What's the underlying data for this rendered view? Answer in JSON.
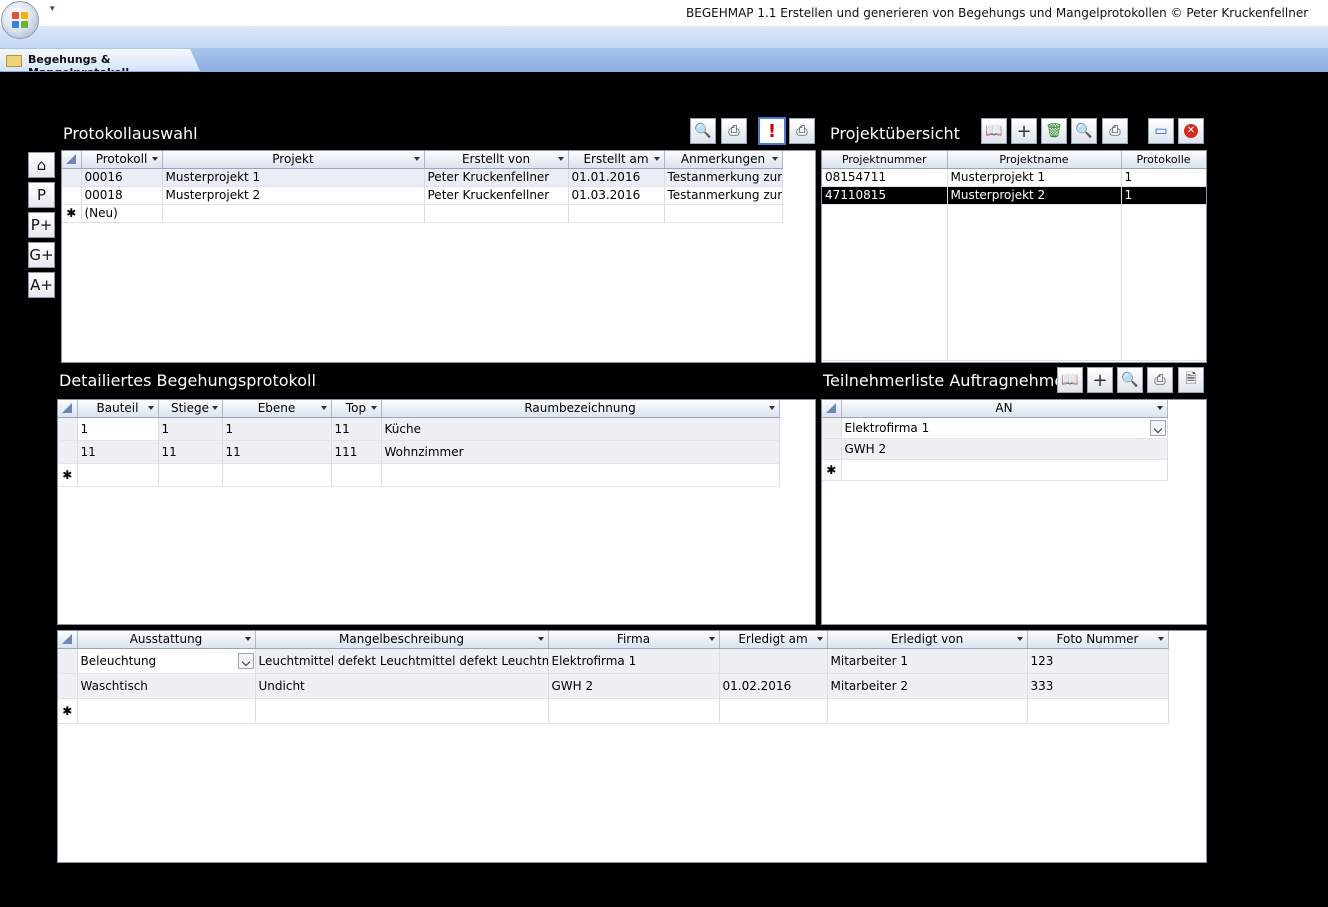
{
  "window": {
    "title": "BEGEHMAP 1.1 Erstellen und generieren von Begehungs und Mangelprotokollen © Peter Kruckenfellner",
    "tab_label": "Begehungs & Mangelprotokoll"
  },
  "nav": [
    {
      "label": "⌂",
      "icon": "home-icon"
    },
    {
      "label": "P"
    },
    {
      "label": "P+"
    },
    {
      "label": "G+"
    },
    {
      "label": "A+"
    }
  ],
  "protokoll": {
    "heading": "Protokollauswahl",
    "columns": [
      "Protokoll",
      "Projekt",
      "Erstellt von",
      "Erstellt am",
      "Anmerkungen"
    ],
    "rows": [
      {
        "protokoll": "00016",
        "projekt": "Musterprojekt 1",
        "erstellt_von": "Peter Kruckenfellner",
        "erstellt_am": "01.01.2016",
        "anmerkungen": "Testanmerkung zur"
      },
      {
        "protokoll": "00018",
        "projekt": "Musterprojekt 2",
        "erstellt_von": "Peter Kruckenfellner",
        "erstellt_am": "01.03.2016",
        "anmerkungen": "Testanmerkung zur"
      }
    ],
    "new_row": "(Neu)"
  },
  "projekt": {
    "heading": "Projektübersicht",
    "columns": [
      "Projektnummer",
      "Projektname",
      "Protokolle"
    ],
    "rows": [
      {
        "nummer": "08154711",
        "name": "Musterprojekt 1",
        "protokolle": "1"
      },
      {
        "nummer": "47110815",
        "name": "Musterprojekt 2",
        "protokolle": "1"
      }
    ]
  },
  "begehung": {
    "heading": "Detailiertes Begehungsprotokoll",
    "columns": [
      "Bauteil",
      "Stiege",
      "Ebene",
      "Top",
      "Raumbezeichnung"
    ],
    "rows": [
      {
        "bauteil": "1",
        "stiege": "1",
        "ebene": "1",
        "top": "11",
        "raum": "Küche"
      },
      {
        "bauteil": "11",
        "stiege": "11",
        "ebene": "11",
        "top": "111",
        "raum": "Wohnzimmer"
      }
    ]
  },
  "teilnehmer": {
    "heading": "Teilnehmerliste Auftragnehmer",
    "columns": [
      "AN"
    ],
    "rows": [
      {
        "an": "Elektrofirma 1"
      },
      {
        "an": "GWH 2"
      }
    ]
  },
  "mangel": {
    "columns": [
      "Ausstattung",
      "Mangelbeschreibung",
      "Firma",
      "Erledigt am",
      "Erledigt von",
      "Foto Nummer"
    ],
    "rows": [
      {
        "ausstattung": "Beleuchtung",
        "beschreibung": "Leuchtmittel defekt Leuchtmittel defekt Leuchtmittel defekt",
        "firma": "Elektrofirma 1",
        "erledigt_am": "",
        "erledigt_von": "Mitarbeiter 1",
        "foto": "123"
      },
      {
        "ausstattung": "Waschtisch",
        "beschreibung": "Undicht",
        "firma": "GWH 2",
        "erledigt_am": "01.02.2016",
        "erledigt_von": "Mitarbeiter 2",
        "foto": "333"
      }
    ]
  },
  "new_row_marker": "✱",
  "colors": {
    "background": "#000000",
    "header_blue": "#c5d8f3",
    "tab_blue": "#8eaee0",
    "selected_row": "#000000"
  }
}
